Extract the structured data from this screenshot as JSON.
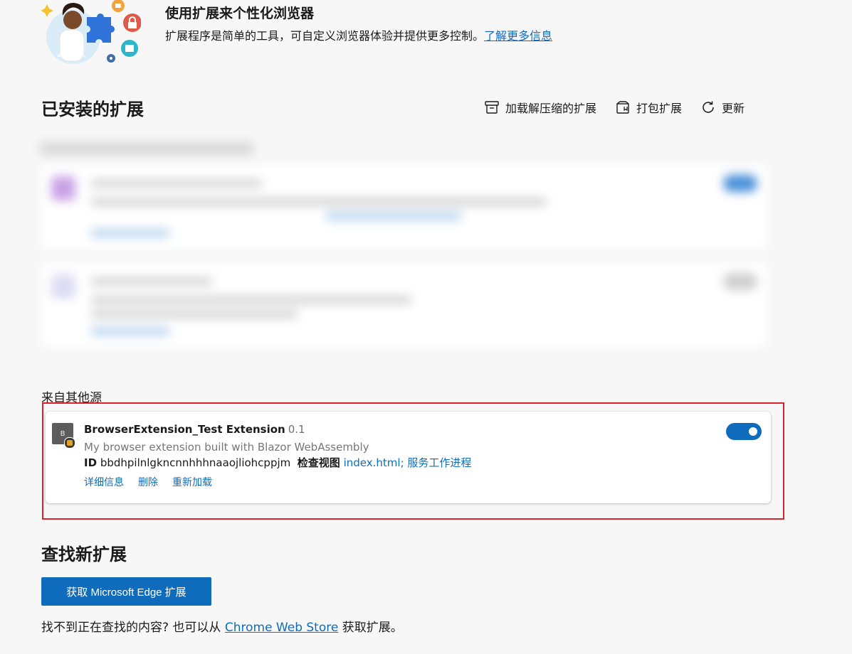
{
  "banner": {
    "title": "使用扩展来个性化浏览器",
    "description": "扩展程序是简单的工具，可自定义浏览器体验并提供更多控制。",
    "learn_more": "了解更多信息"
  },
  "installed": {
    "title": "已安装的扩展",
    "toolbar": {
      "load_unpacked": "加载解压缩的扩展",
      "pack": "打包扩展",
      "update": "更新"
    }
  },
  "other_sources": {
    "label": "来自其他源",
    "extension": {
      "icon_letter": "B",
      "name": "BrowserExtension_Test Extension",
      "version": "0.1",
      "description": "My browser extension built with Blazor WebAssembly",
      "id_label": "ID",
      "id_value": "bbdhpilnlgkncnnhhhnaaojliohcppjm",
      "inspect_label": "检查视图",
      "inspect_links": "index.html; 服务工作进程",
      "enabled": true,
      "actions": {
        "details": "详细信息",
        "remove": "删除",
        "reload": "重新加载"
      }
    }
  },
  "find_new": {
    "title": "查找新扩展",
    "button": "获取 Microsoft Edge 扩展",
    "footer_prefix": "找不到正在查找的内容? 也可以从",
    "footer_link": "Chrome Web Store",
    "footer_suffix": "获取扩展。"
  },
  "colors": {
    "accent": "#0f6cbd",
    "highlight_frame": "#d9232b",
    "background": "#f7f7f7"
  }
}
